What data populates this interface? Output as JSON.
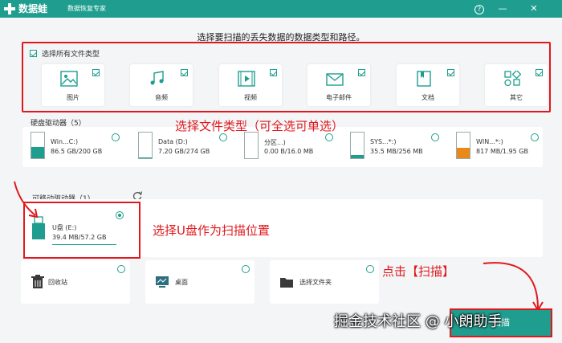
{
  "titlebar": {
    "app_name": "数据蛙",
    "subtitle": "数据恢复专家",
    "help": "?",
    "minimize": "—",
    "close": "✕"
  },
  "headline": "选择要扫描的丢失数据的数据类型和路径。",
  "file_types": {
    "select_all": "选择所有文件类型",
    "items": [
      {
        "label": "图片",
        "icon": "image-icon"
      },
      {
        "label": "音频",
        "icon": "music-icon"
      },
      {
        "label": "视频",
        "icon": "video-icon"
      },
      {
        "label": "电子邮件",
        "icon": "mail-icon"
      },
      {
        "label": "文档",
        "icon": "document-icon"
      },
      {
        "label": "其它",
        "icon": "other-icon"
      }
    ]
  },
  "hard_drives": {
    "title": "硬盘驱动器（5）",
    "items": [
      {
        "name": "Win...C:)",
        "size": "86.5 GB/200 GB",
        "fill": 0.43,
        "color": "#1f9e8f"
      },
      {
        "name": "Data (D:)",
        "size": "7.20 GB/274 GB",
        "fill": 0.03,
        "color": "#1f9e8f"
      },
      {
        "name": "分区...)",
        "size": "0.00  B/16.0 MB",
        "fill": 0.0,
        "color": "#1f9e8f"
      },
      {
        "name": "SYS...*:)",
        "size": "35.5 MB/256 MB",
        "fill": 0.14,
        "color": "#1f9e8f"
      },
      {
        "name": "WIN...*:)",
        "size": "817 MB/1.95 GB",
        "fill": 0.42,
        "color": "#e8891a"
      }
    ]
  },
  "removable": {
    "title": "可移动驱动器（1）",
    "drive": {
      "name": "U盘 (E:)",
      "size": "39.4 MB/57.2 GB"
    }
  },
  "quick_locations": [
    {
      "label": "回收站",
      "icon": "trash-icon"
    },
    {
      "label": "桌面",
      "icon": "desktop-icon"
    },
    {
      "label": "选择文件夹",
      "icon": "folder-icon"
    }
  ],
  "annotations": {
    "file_type": "选择文件类型（可全选可单选）",
    "usb": "选择U盘作为扫描位置",
    "scan": "点击【扫描】"
  },
  "scan_button": "扫描",
  "watermark": "掘金技术社区 @ 小朗助手"
}
